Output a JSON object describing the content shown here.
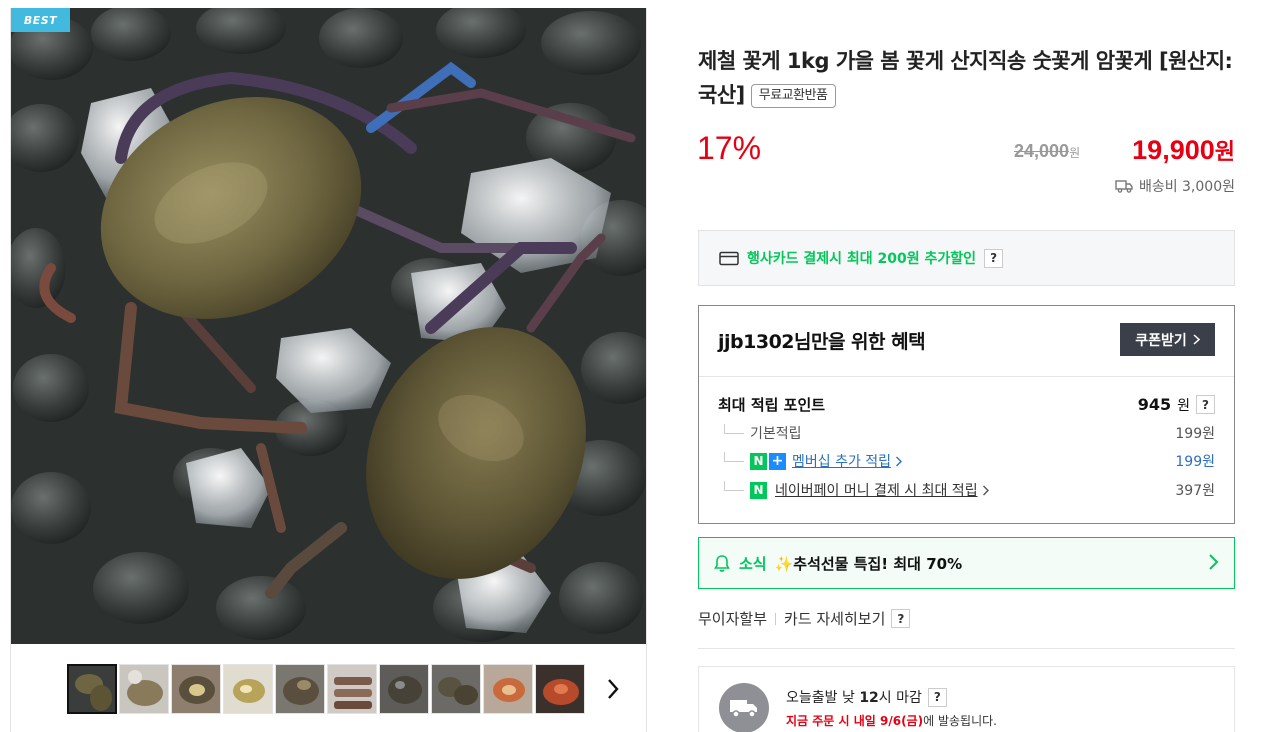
{
  "gallery": {
    "badge": "BEST",
    "thumbnail_count": 10
  },
  "product": {
    "title": "제철 꽃게 1kg 가을 봄 꽃게 산지직송 숫꽃게 암꽃게 [원산지:국산]",
    "free_exchange_badge": "무료교환반품",
    "discount": "17%",
    "original_price": "24,000",
    "original_price_unit": "원",
    "sale_price": "19,900",
    "sale_price_unit": "원",
    "shipping": "배송비 3,000원"
  },
  "card_promo": {
    "text": "행사카드 결제시 최대 200원 추가할인",
    "help": "?"
  },
  "benefits": {
    "title": "jjb1302님만을 위한 혜택",
    "coupon_button": "쿠폰받기",
    "max_points_label": "최대 적립 포인트",
    "max_points_value": "945",
    "max_points_unit": "원",
    "help": "?",
    "rows": [
      {
        "label": "기본적립",
        "value": "199원"
      },
      {
        "label": "멤버십 추가 적립",
        "value": "199원"
      },
      {
        "label": "네이버페이 머니 결제 시 최대 적립",
        "value": "397원"
      }
    ]
  },
  "news": {
    "label": "소식",
    "text": "✨추석선물 특집! 최대 70%"
  },
  "pay_links": {
    "installment": "무이자할부",
    "card_detail": "카드 자세히보기",
    "help": "?"
  },
  "delivery": {
    "line1_prefix": "오늘출발 낮 ",
    "line1_time": "12",
    "line1_suffix": "시 마감",
    "help": "?",
    "line2_highlight": "지금 주문 시 내일 9/6(금)",
    "line2_rest": "에 발송됩니다."
  },
  "colors": {
    "accent_red": "#e60012",
    "naver_green": "#03c75a",
    "badge_blue": "#42b9de"
  }
}
